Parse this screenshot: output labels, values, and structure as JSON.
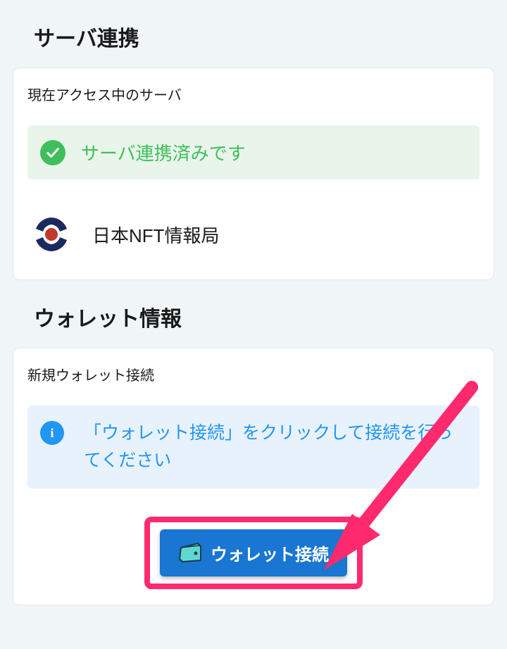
{
  "server_link": {
    "title": "サーバ連携",
    "subtitle": "現在アクセス中のサーバ",
    "status_text": "サーバ連携済みです",
    "server_name": "日本NFT情報局"
  },
  "wallet_info": {
    "title": "ウォレット情報",
    "subtitle": "新規ウォレット接続",
    "info_text": "「ウォレット接続」をクリックして接続を行ってください",
    "connect_button_label": "ウォレット接続"
  }
}
